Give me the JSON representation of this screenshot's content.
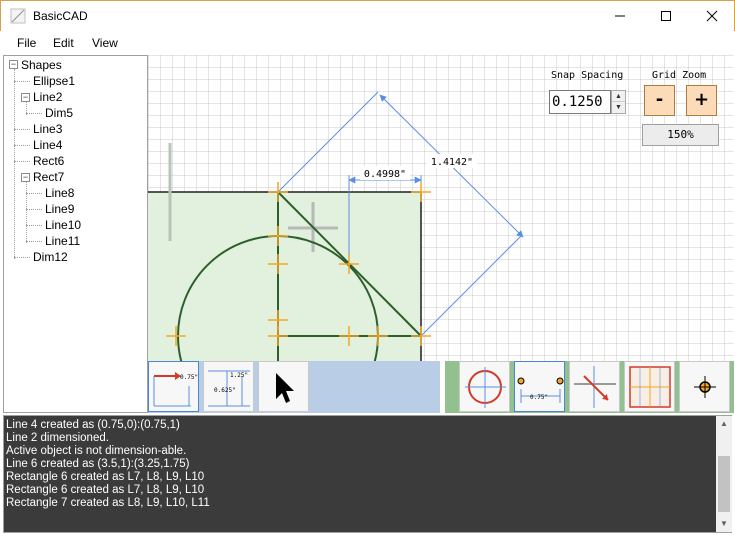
{
  "window": {
    "title": "BasicCAD"
  },
  "menu": {
    "items": [
      "File",
      "Edit",
      "View"
    ]
  },
  "tree": {
    "root": "Shapes",
    "items": [
      "Ellipse1",
      "Line2",
      "Dim5",
      "Line3",
      "Line4",
      "Rect6",
      "Rect7",
      "Line8",
      "Line9",
      "Line10",
      "Line11",
      "Dim12"
    ]
  },
  "controls": {
    "snap_label": "Snap Spacing",
    "snap_value": "0.1250",
    "grid_label": "Grid Zoom",
    "zoom_minus": "-",
    "zoom_plus": "+",
    "zoom_level": "150%"
  },
  "canvas": {
    "dim_horizontal": "0.4998\"",
    "dim_diagonal": "1.4142\""
  },
  "toolbar": {
    "dim_tool_label": "0.75\"",
    "dim_tool2_label_a": "1.25\"",
    "dim_tool2_label_b": "0.625\"",
    "snap_tool_label": "0.75\""
  },
  "log": {
    "lines": [
      "Line 4 created as (0.75,0):(0.75,1)",
      "Line 2 dimensioned.",
      "Active object is not dimension-able.",
      "Line 6 created as (3.5,1):(3.25,1.75)",
      "Rectangle 6 created as L7, L8, L9, L10",
      "Rectangle 6 created as L7, L8, L9, L10",
      "Rectangle 7 created as L8, L9, L10, L11"
    ]
  },
  "colors": {
    "accent_orange": "#f5a623",
    "shape_green": "#2d5f2d",
    "dim_blue": "#5b8fe0",
    "fill_green": "#e2f1de",
    "log_bg": "#3b3b3b"
  }
}
